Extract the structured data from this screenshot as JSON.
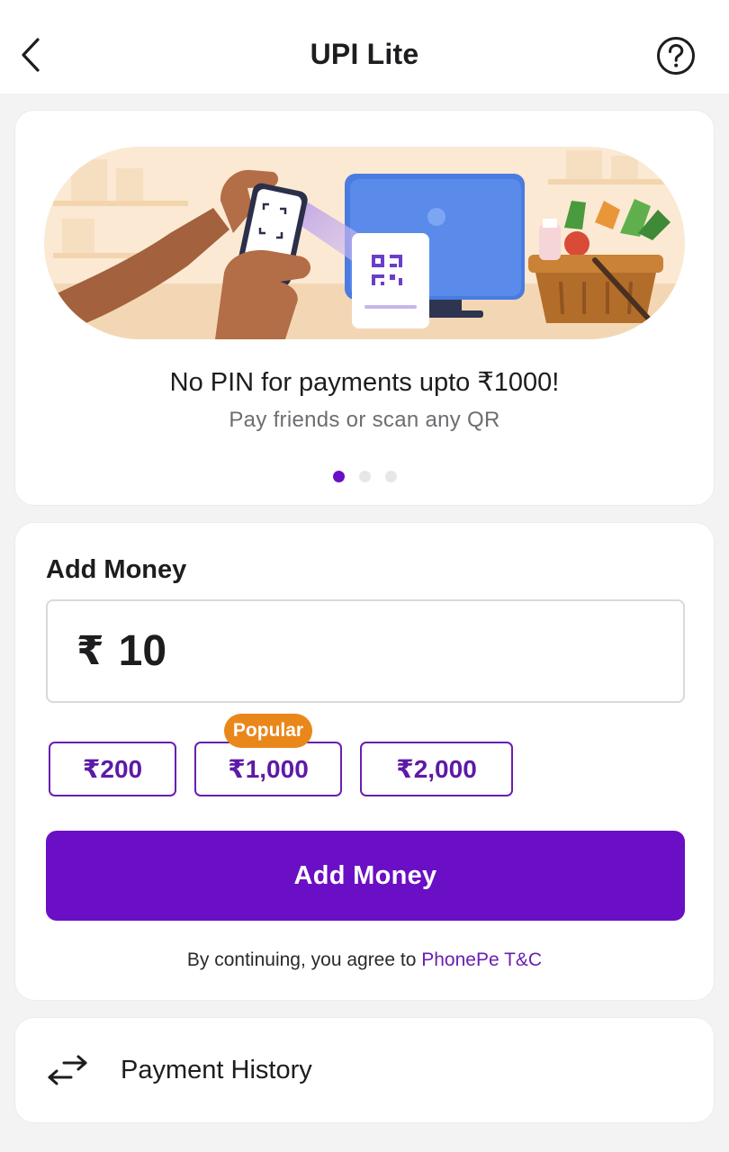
{
  "header": {
    "title": "UPI Lite",
    "back_icon": "chevron-left-icon",
    "help_icon": "question-circle-icon"
  },
  "banner": {
    "illustration": "phone-scanning-qr-at-grocery-counter",
    "title": "No PIN for payments upto ₹1000!",
    "subtitle": "Pay friends or scan any QR",
    "slides_total": 3,
    "active_slide": 1
  },
  "add_money": {
    "section_title": "Add Money",
    "currency_symbol": "₹",
    "amount_value": "10",
    "quick_amounts": [
      "₹200",
      "₹1,000",
      "₹2,000"
    ],
    "popular_badge": "Popular",
    "button_label": "Add Money",
    "terms_prefix": "By continuing, you agree to ",
    "terms_link": "PhonePe T&C"
  },
  "payment_history": {
    "icon": "transfer-arrows-icon",
    "label": "Payment History"
  },
  "colors": {
    "accent": "#6a0fc5",
    "badge": "#e9871a",
    "background": "#f3f3f3"
  }
}
